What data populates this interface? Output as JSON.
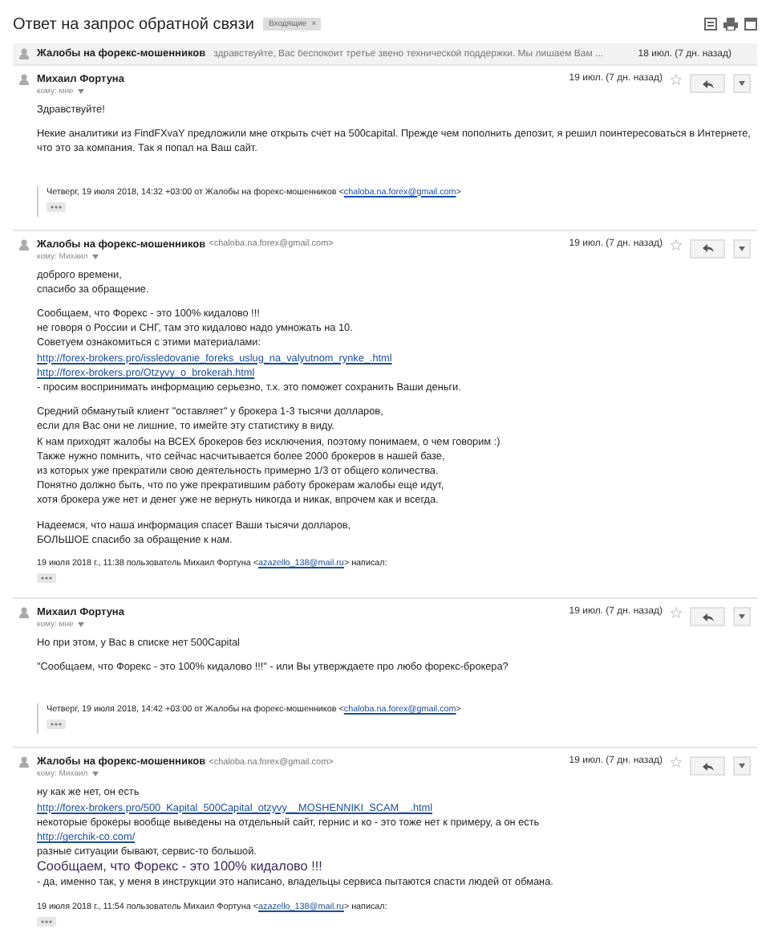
{
  "thread": {
    "title": "Ответ на запрос обратной связи",
    "label": {
      "text": "Входящие",
      "close": "×"
    }
  },
  "messages": [
    {
      "kind": "collapsed",
      "sender": "Жалобы на форекс-мошенников",
      "snippet": "здравствуйте, Вас беспокоит третье звено технической поддержки. Мы лишаем Вам ...",
      "date": "18 июл. (7 дн. назад)"
    },
    {
      "kind": "expanded",
      "sender": "Михаил Фортуна",
      "to": "кому: мне",
      "date": "19 июл. (7 дн. назад)",
      "paragraphs": [
        [
          {
            "kind": "text",
            "text": "Здравствуйте!"
          }
        ],
        [
          {
            "kind": "text",
            "text": "Некие аналитики из FindFXvaY  предложили мне открыть счет на 500capital.  Прежде чем пополнить депозит, я решил поинтересоваться в Интернете,  что это за компания. Так я попал на Ваш сайт."
          }
        ]
      ],
      "quote": {
        "kind": "bar",
        "parts": [
          {
            "kind": "text",
            "text": "Четверг, 19 июля 2018, 14:32 +03:00 от Жалобы на форекс-мошенников <"
          },
          {
            "kind": "link",
            "text": "chaloba.na.forex@gmail.com"
          },
          {
            "kind": "text",
            "text": ">"
          }
        ]
      }
    },
    {
      "kind": "expanded",
      "sender": "Жалобы на форекс-мошенников",
      "email": "<chaloba.na.forex@gmail.com>",
      "to": "кому: Михаил",
      "date": "19 июл. (7 дн. назад)",
      "paragraphs": [
        [
          {
            "kind": "text",
            "text": "доброго времени,"
          },
          {
            "kind": "text",
            "text": "спасибо за обращение."
          }
        ],
        [
          {
            "kind": "text",
            "text": "Сообщаем, что Форекс - это 100% кидалово !!!"
          },
          {
            "kind": "text",
            "text": "не говоря о России и СНГ, там это кидалово надо умножать на 10."
          },
          {
            "kind": "text",
            "text": "Советуем ознакомиться с этими материалами:"
          },
          {
            "kind": "link",
            "text": "http://forex-brokers.pro/issledovanie_foreks_uslug_na_valyutnom_rynke_.html"
          },
          {
            "kind": "link",
            "text": "http://forex-brokers.pro/Otzyvy_o_brokerah.html"
          },
          {
            "kind": "text",
            "text": " - просим воспринимать информацию серьезно, т.х. это поможет сохранить Ваши деньги."
          }
        ],
        [
          {
            "kind": "text",
            "text": "Средний обманутый клиент \"оставляет\" у брокера 1-3 тысячи долларов,"
          },
          {
            "kind": "text",
            "text": "если для Вас они не лишние, то имейте эту статистику в виду."
          },
          {
            "kind": "text",
            "text": "К нам приходят жалобы на ВСЕХ брокеров без исключения, поэтому понимаем, о чем говорим :)"
          },
          {
            "kind": "text",
            "text": "Также нужно помнить, что сейчас насчитывается более 2000 брокеров в нашей базе,"
          },
          {
            "kind": "text",
            "text": "из которых уже прекратили свою деятельность примерно 1/3 от общего количества."
          },
          {
            "kind": "text",
            "text": "Понятно должно быть, что по уже прекратившим работу брокерам жалобы еще идут,"
          },
          {
            "kind": "text",
            "text": "хотя брокера уже нет и денег уже не вернуть никогда и никак, впрочем как и всегда."
          }
        ],
        [
          {
            "kind": "text",
            "text": "Надеемся, что наша информация спасет Ваши тысячи долларов,"
          },
          {
            "kind": "text",
            "text": "БОЛЬШОЕ спасибо за обращение к нам."
          }
        ]
      ],
      "quote": {
        "kind": "plain",
        "parts": [
          {
            "kind": "text",
            "text": "19 июля 2018 г., 11:38 пользователь Михаил Фортуна <"
          },
          {
            "kind": "link",
            "text": "azazello_138@mail.ru"
          },
          {
            "kind": "text",
            "text": "> написал:"
          }
        ]
      }
    },
    {
      "kind": "expanded",
      "sender": "Михаил Фортуна",
      "to": "кому: мне",
      "date": "19 июл. (7 дн. назад)",
      "paragraphs": [
        [
          {
            "kind": "text",
            "text": "Но при этом, у Вас в списке нет 500Capital"
          }
        ],
        [
          {
            "kind": "text",
            "text": "\"Сообщаем, что Форекс - это 100% кидалово !!!\" - или Вы утверждаете про любо форекс-брокера?"
          }
        ]
      ],
      "quote": {
        "kind": "bar",
        "parts": [
          {
            "kind": "text",
            "text": "Четверг, 19 июля 2018, 14:42 +03:00 от Жалобы на форекс-мошенников <"
          },
          {
            "kind": "link",
            "text": "chaloba.na.forex@gmail.com"
          },
          {
            "kind": "text",
            "text": ">"
          }
        ]
      }
    },
    {
      "kind": "expanded",
      "sender": "Жалобы на форекс-мошенников",
      "email": "<chaloba.na.forex@gmail.com>",
      "to": "кому: Михаил",
      "date": "19 июл. (7 дн. назад)",
      "paragraphs": [
        [
          {
            "kind": "text",
            "text": "ну как же нет, он есть"
          },
          {
            "kind": "link",
            "text": "http://forex-brokers.pro/500_Kapital_500Capital_otzyvy__MOSHENNIKI_SCAM__.html"
          },
          {
            "kind": "text",
            "text": "некоторые брокеры вообще выведены на отдельный сайт, гернис и ко - это тоже нет к примеру, а он есть"
          },
          {
            "kind": "link",
            "text": "http://gerchik-co.com/"
          },
          {
            "kind": "text",
            "text": "разные ситуации бывают, сервис-то большой."
          },
          {
            "kind": "big",
            "text": "Сообщаем, что Форекс - это 100% кидалово !!!"
          },
          {
            "kind": "text",
            "text": "- да, именно так, у меня в инструкции это написано, владельцы сервиса пытаются спасти людей от обмана."
          }
        ]
      ],
      "quote": {
        "kind": "plain",
        "parts": [
          {
            "kind": "text",
            "text": "19 июля 2018 г., 11:54 пользователь Михаил Фортуна <"
          },
          {
            "kind": "link",
            "text": "azazello_138@mail.ru"
          },
          {
            "kind": "text",
            "text": "> написал:"
          }
        ]
      }
    }
  ]
}
